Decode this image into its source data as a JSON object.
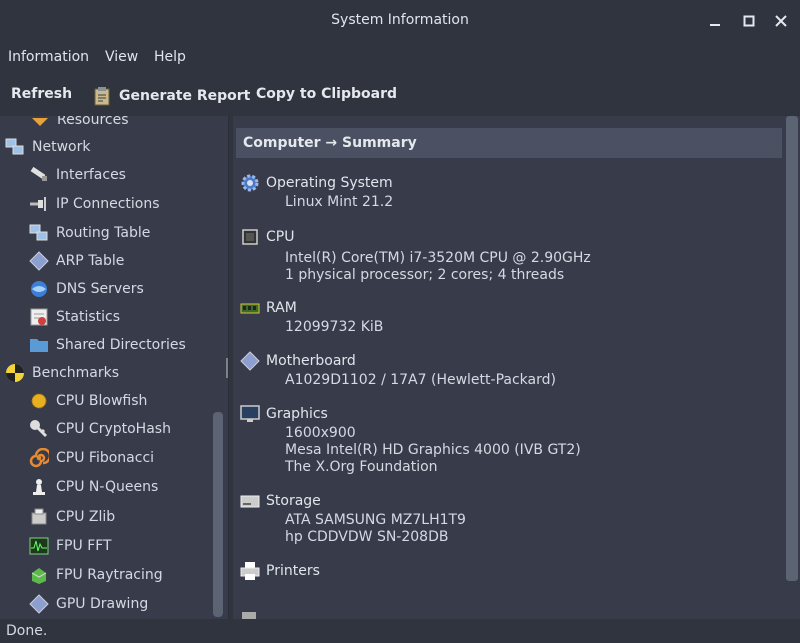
{
  "window": {
    "title": "System Information"
  },
  "menu": [
    "Information",
    "View",
    "Help"
  ],
  "toolbar": {
    "refresh": "Refresh",
    "generate_report": "Generate Report",
    "copy_clipboard": "Copy to Clipboard"
  },
  "sidebar": {
    "partial_top": "Resources",
    "items": [
      {
        "label": "Network",
        "icon": "network-icon",
        "level": 0
      },
      {
        "label": "Interfaces",
        "icon": "interfaces-icon",
        "level": 1
      },
      {
        "label": "IP Connections",
        "icon": "ip-connections-icon",
        "level": 1
      },
      {
        "label": "Routing Table",
        "icon": "routing-table-icon",
        "level": 1
      },
      {
        "label": "ARP Table",
        "icon": "arp-table-icon",
        "level": 1
      },
      {
        "label": "DNS Servers",
        "icon": "dns-servers-icon",
        "level": 1
      },
      {
        "label": "Statistics",
        "icon": "statistics-icon",
        "level": 1
      },
      {
        "label": "Shared Directories",
        "icon": "shared-directories-icon",
        "level": 1
      },
      {
        "label": "Benchmarks",
        "icon": "benchmarks-icon",
        "level": 0
      },
      {
        "label": "CPU Blowfish",
        "icon": "blowfish-icon",
        "level": 1
      },
      {
        "label": "CPU CryptoHash",
        "icon": "cryptohash-icon",
        "level": 1
      },
      {
        "label": "CPU Fibonacci",
        "icon": "fibonacci-icon",
        "level": 1
      },
      {
        "label": "CPU N-Queens",
        "icon": "n-queens-icon",
        "level": 1
      },
      {
        "label": "CPU Zlib",
        "icon": "zlib-icon",
        "level": 1
      },
      {
        "label": "FPU FFT",
        "icon": "fft-icon",
        "level": 1
      },
      {
        "label": "FPU Raytracing",
        "icon": "raytracing-icon",
        "level": 1
      },
      {
        "label": "GPU Drawing",
        "icon": "gpu-drawing-icon",
        "level": 1
      }
    ]
  },
  "main": {
    "header": "Computer → Summary",
    "sections": [
      {
        "title": "Operating System",
        "icon": "gear-icon",
        "lines": [
          "Linux Mint 21.2"
        ]
      },
      {
        "title": "CPU",
        "icon": "cpu-chip-icon",
        "lines": [
          "Intel(R) Core(TM) i7-3520M CPU @ 2.90GHz",
          "1 physical processor; 2 cores; 4 threads"
        ]
      },
      {
        "title": "RAM",
        "icon": "memory-icon",
        "lines": [
          "12099732 KiB"
        ]
      },
      {
        "title": "Motherboard",
        "icon": "motherboard-icon",
        "lines": [
          "A1029D1102 / 17A7 (Hewlett-Packard)"
        ]
      },
      {
        "title": "Graphics",
        "icon": "monitor-icon",
        "lines": [
          "1600x900",
          "Mesa Intel(R) HD Graphics 4000 (IVB GT2)",
          "The X.Org Foundation"
        ]
      },
      {
        "title": "Storage",
        "icon": "storage-icon",
        "lines": [
          "ATA SAMSUNG MZ7LH1T9",
          "hp CDDVDW SN-208DB"
        ]
      },
      {
        "title": "Printers",
        "icon": "printer-icon",
        "lines": []
      }
    ]
  },
  "status": "Done."
}
